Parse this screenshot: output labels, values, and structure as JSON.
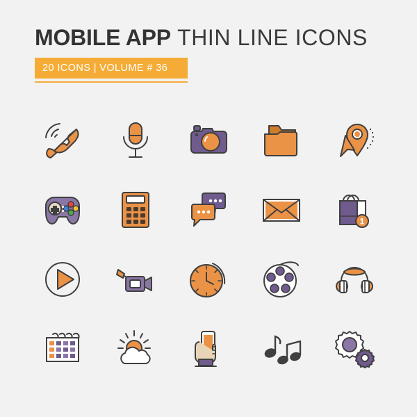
{
  "header": {
    "title_bold": "MOBILE APP",
    "title_thin": "THIN LINE ICONS",
    "badge_text": "20 ICONS | VOLUME # 36"
  },
  "colors": {
    "background": "#f2f2f2",
    "accent_orange": "#ea9246",
    "orange_dark": "#cf7c2c",
    "orange_badge": "#f5ac36",
    "purple": "#6f5b8e",
    "purple_light": "#8a77a6",
    "stroke": "#3f3f3f",
    "title_dark": "#333333",
    "white": "#ffffff",
    "cream": "#e8dcc8"
  },
  "icons": [
    {
      "name": "phone-call-icon",
      "label": "Phone Call"
    },
    {
      "name": "microphone-icon",
      "label": "Microphone"
    },
    {
      "name": "photo-camera-icon",
      "label": "Photo Camera"
    },
    {
      "name": "folder-icon",
      "label": "Folder"
    },
    {
      "name": "map-pin-navigation-icon",
      "label": "Map Pin Navigation"
    },
    {
      "name": "gamepad-icon",
      "label": "Game Controller"
    },
    {
      "name": "calculator-icon",
      "label": "Calculator"
    },
    {
      "name": "chat-bubbles-icon",
      "label": "Chat Bubbles"
    },
    {
      "name": "envelope-mail-icon",
      "label": "Mail Envelope"
    },
    {
      "name": "shopping-bag-icon",
      "label": "Shopping Bag",
      "badge": "1"
    },
    {
      "name": "play-button-icon",
      "label": "Play Button"
    },
    {
      "name": "video-camera-icon",
      "label": "Video Camera"
    },
    {
      "name": "clock-icon",
      "label": "Clock"
    },
    {
      "name": "film-reel-icon",
      "label": "Film Reel"
    },
    {
      "name": "headphones-icon",
      "label": "Headphones"
    },
    {
      "name": "calendar-icon",
      "label": "Calendar"
    },
    {
      "name": "weather-sun-cloud-icon",
      "label": "Weather Sun Cloud"
    },
    {
      "name": "hand-holding-phone-icon",
      "label": "Hand Holding Phone"
    },
    {
      "name": "music-notes-icon",
      "label": "Music Notes"
    },
    {
      "name": "settings-gears-icon",
      "label": "Settings Gears"
    }
  ]
}
